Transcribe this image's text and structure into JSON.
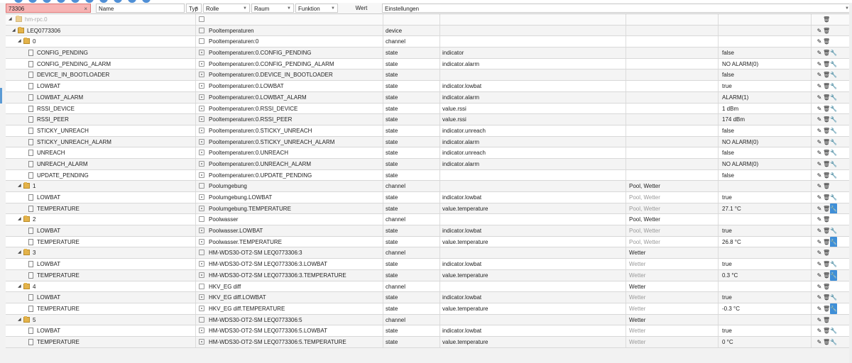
{
  "filters": {
    "id_value": "73306",
    "clear": "×",
    "name_placeholder": "Name",
    "typ": "Typ",
    "rolle": "Rolle",
    "raum": "Raum",
    "funktion": "Funktion",
    "wert": "Wert",
    "einstellungen": "Einstellungen"
  },
  "icons": {
    "edit": "✎",
    "delete": "🗑",
    "settings": "🔧"
  },
  "root": {
    "name": "hm-rpc.0"
  },
  "rows": [
    {
      "name": "LEQ0773306",
      "obj": "Pooltemperaturen",
      "type": "device",
      "role": "",
      "room": "",
      "func": "",
      "value": "",
      "kind": "device",
      "lvl": 1
    },
    {
      "name": "0",
      "obj": "Pooltemperaturen:0",
      "type": "channel",
      "role": "",
      "room": "",
      "func": "",
      "value": "",
      "kind": "channel",
      "lvl": 2
    },
    {
      "name": "CONFIG_PENDING",
      "obj": "Pooltemperaturen:0.CONFIG_PENDING",
      "type": "state",
      "role": "indicator",
      "room": "",
      "func": "",
      "value": "false",
      "kind": "state",
      "lvl": 3
    },
    {
      "name": "CONFIG_PENDING_ALARM",
      "obj": "Pooltemperaturen:0.CONFIG_PENDING_ALARM",
      "type": "state",
      "role": "indicator.alarm",
      "room": "",
      "func": "",
      "value": "NO ALARM(0)",
      "kind": "state",
      "lvl": 3
    },
    {
      "name": "DEVICE_IN_BOOTLOADER",
      "obj": "Pooltemperaturen:0.DEVICE_IN_BOOTLOADER",
      "type": "state",
      "role": "",
      "room": "",
      "func": "",
      "value": "false",
      "kind": "state",
      "lvl": 3
    },
    {
      "name": "LOWBAT",
      "obj": "Pooltemperaturen:0.LOWBAT",
      "type": "state",
      "role": "indicator.lowbat",
      "room": "",
      "func": "",
      "value": "true",
      "kind": "state",
      "lvl": 3
    },
    {
      "name": "LOWBAT_ALARM",
      "obj": "Pooltemperaturen:0.LOWBAT_ALARM",
      "type": "state",
      "role": "indicator.alarm",
      "room": "",
      "func": "",
      "value": "ALARM(1)",
      "kind": "state",
      "lvl": 3
    },
    {
      "name": "RSSI_DEVICE",
      "obj": "Pooltemperaturen:0.RSSI_DEVICE",
      "type": "state",
      "role": "value.rssi",
      "room": "",
      "func": "",
      "value": "1 dBm",
      "kind": "state",
      "lvl": 3
    },
    {
      "name": "RSSI_PEER",
      "obj": "Pooltemperaturen:0.RSSI_PEER",
      "type": "state",
      "role": "value.rssi",
      "room": "",
      "func": "",
      "value": "174 dBm",
      "kind": "state",
      "lvl": 3
    },
    {
      "name": "STICKY_UNREACH",
      "obj": "Pooltemperaturen:0.STICKY_UNREACH",
      "type": "state",
      "role": "indicator.unreach",
      "room": "",
      "func": "",
      "value": "false",
      "kind": "state",
      "lvl": 3
    },
    {
      "name": "STICKY_UNREACH_ALARM",
      "obj": "Pooltemperaturen:0.STICKY_UNREACH_ALARM",
      "type": "state",
      "role": "indicator.alarm",
      "room": "",
      "func": "",
      "value": "NO ALARM(0)",
      "kind": "state",
      "lvl": 3
    },
    {
      "name": "UNREACH",
      "obj": "Pooltemperaturen:0.UNREACH",
      "type": "state",
      "role": "indicator.unreach",
      "room": "",
      "func": "",
      "value": "false",
      "kind": "state",
      "lvl": 3
    },
    {
      "name": "UNREACH_ALARM",
      "obj": "Pooltemperaturen:0.UNREACH_ALARM",
      "type": "state",
      "role": "indicator.alarm",
      "room": "",
      "func": "",
      "value": "NO ALARM(0)",
      "kind": "state",
      "lvl": 3
    },
    {
      "name": "UPDATE_PENDING",
      "obj": "Pooltemperaturen:0.UPDATE_PENDING",
      "type": "state",
      "role": "",
      "room": "",
      "func": "",
      "value": "false",
      "kind": "state",
      "lvl": 3
    },
    {
      "name": "1",
      "obj": "Poolumgebung",
      "type": "channel",
      "role": "",
      "room": "Pool, Wetter",
      "func": "",
      "value": "",
      "kind": "channel",
      "lvl": 2
    },
    {
      "name": "LOWBAT",
      "obj": "Poolumgebung.LOWBAT",
      "type": "state",
      "role": "indicator.lowbat",
      "room": "Pool, Wetter",
      "func": "",
      "value": "true",
      "kind": "state",
      "lvl": 3,
      "dimroom": true
    },
    {
      "name": "TEMPERATURE",
      "obj": "Poolumgebung.TEMPERATURE",
      "type": "state",
      "role": "value.temperature",
      "room": "Pool, Wetter",
      "func": "",
      "value": "27.1 °C",
      "kind": "state",
      "lvl": 3,
      "dimroom": true,
      "blue": true
    },
    {
      "name": "2",
      "obj": "Poolwasser",
      "type": "channel",
      "role": "",
      "room": "Pool, Wetter",
      "func": "",
      "value": "",
      "kind": "channel",
      "lvl": 2
    },
    {
      "name": "LOWBAT",
      "obj": "Poolwasser.LOWBAT",
      "type": "state",
      "role": "indicator.lowbat",
      "room": "Pool, Wetter",
      "func": "",
      "value": "true",
      "kind": "state",
      "lvl": 3,
      "dimroom": true
    },
    {
      "name": "TEMPERATURE",
      "obj": "Poolwasser.TEMPERATURE",
      "type": "state",
      "role": "value.temperature",
      "room": "Pool, Wetter",
      "func": "",
      "value": "26.8 °C",
      "kind": "state",
      "lvl": 3,
      "dimroom": true,
      "blue": true
    },
    {
      "name": "3",
      "obj": "HM-WDS30-OT2-SM LEQ0773306:3",
      "type": "channel",
      "role": "",
      "room": "Wetter",
      "func": "",
      "value": "",
      "kind": "channel",
      "lvl": 2
    },
    {
      "name": "LOWBAT",
      "obj": "HM-WDS30-OT2-SM LEQ0773306:3.LOWBAT",
      "type": "state",
      "role": "indicator.lowbat",
      "room": "Wetter",
      "func": "",
      "value": "true",
      "kind": "state",
      "lvl": 3,
      "dimroom": true
    },
    {
      "name": "TEMPERATURE",
      "obj": "HM-WDS30-OT2-SM LEQ0773306:3.TEMPERATURE",
      "type": "state",
      "role": "value.temperature",
      "room": "Wetter",
      "func": "",
      "value": "0.3 °C",
      "kind": "state",
      "lvl": 3,
      "dimroom": true,
      "blue": true
    },
    {
      "name": "4",
      "obj": "HKV_EG diff",
      "type": "channel",
      "role": "",
      "room": "Wetter",
      "func": "",
      "value": "",
      "kind": "channel",
      "lvl": 2
    },
    {
      "name": "LOWBAT",
      "obj": "HKV_EG diff.LOWBAT",
      "type": "state",
      "role": "indicator.lowbat",
      "room": "Wetter",
      "func": "",
      "value": "true",
      "kind": "state",
      "lvl": 3,
      "dimroom": true
    },
    {
      "name": "TEMPERATURE",
      "obj": "HKV_EG diff.TEMPERATURE",
      "type": "state",
      "role": "value.temperature",
      "room": "Wetter",
      "func": "",
      "value": "-0.3 °C",
      "kind": "state",
      "lvl": 3,
      "dimroom": true,
      "blue": true
    },
    {
      "name": "5",
      "obj": "HM-WDS30-OT2-SM LEQ0773306:5",
      "type": "channel",
      "role": "",
      "room": "Wetter",
      "func": "",
      "value": "",
      "kind": "channel",
      "lvl": 2
    },
    {
      "name": "LOWBAT",
      "obj": "HM-WDS30-OT2-SM LEQ0773306:5.LOWBAT",
      "type": "state",
      "role": "indicator.lowbat",
      "room": "Wetter",
      "func": "",
      "value": "true",
      "kind": "state",
      "lvl": 3,
      "dimroom": true
    },
    {
      "name": "TEMPERATURE",
      "obj": "HM-WDS30-OT2-SM LEQ0773306:5.TEMPERATURE",
      "type": "state",
      "role": "value.temperature",
      "room": "Wetter",
      "func": "",
      "value": "0 °C",
      "kind": "state",
      "lvl": 3,
      "dimroom": true
    }
  ]
}
